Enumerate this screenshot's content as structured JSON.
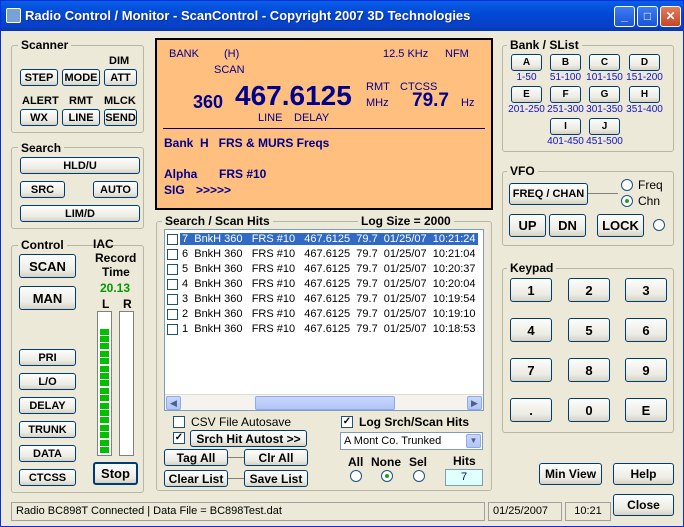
{
  "window": {
    "title": "Radio Control / Monitor - ScanControl - Copyright 2007 3D Technologies",
    "minimize": "_",
    "maximize": "□",
    "close": "✕"
  },
  "scanner": {
    "title": "Scanner",
    "dim_label": "DIM",
    "step": "STEP",
    "mode": "MODE",
    "att": "ATT",
    "alert_label": "ALERT",
    "rmt_label": "RMT",
    "mlck_label": "MLCK",
    "wx": "WX",
    "line": "LINE",
    "send": "SEND"
  },
  "search": {
    "title": "Search",
    "hldu": "HLD/U",
    "src": "SRC",
    "auto": "AUTO",
    "limd": "LIM/D"
  },
  "control": {
    "title": "Control",
    "scan": "SCAN",
    "man": "MAN",
    "pri": "PRI",
    "lo": "L/O",
    "delay": "DELAY",
    "trunk": "TRUNK",
    "data": "DATA",
    "ctcss": "CTCSS"
  },
  "iac": {
    "title": "IAC",
    "record": "Record",
    "time_label": "Time",
    "time_value": "20.13",
    "left": "L",
    "right": "R",
    "stop": "Stop",
    "left_level": 0.9,
    "right_level": 0.0
  },
  "display": {
    "bank": "BANK",
    "bank_id": "(H)",
    "freq_step": "12.5 KHz",
    "mode": "NFM",
    "scan": "SCAN",
    "channel": "360",
    "frequency": "467.6125",
    "rmt": "RMT",
    "mhz": "MHz",
    "ctcss": "CTCSS",
    "tone": "79.7",
    "hz": "Hz",
    "line": "LINE",
    "delay": "DELAY",
    "bank_line": "Bank  H   FRS & MURS Freqs",
    "alpha_label": "Alpha",
    "alpha_value": "FRS #10",
    "sig_label": "SIG",
    "sig_value": ">>>>>"
  },
  "banks": {
    "title": "Bank / SList",
    "items": [
      {
        "key": "A",
        "range": "1-50"
      },
      {
        "key": "B",
        "range": "51-100"
      },
      {
        "key": "C",
        "range": "101-150"
      },
      {
        "key": "D",
        "range": "151-200"
      },
      {
        "key": "E",
        "range": "201-250"
      },
      {
        "key": "F",
        "range": "251-300"
      },
      {
        "key": "G",
        "range": "301-350"
      },
      {
        "key": "H",
        "range": "351-400"
      },
      {
        "key": "I",
        "range": "401-450"
      },
      {
        "key": "J",
        "range": "451-500"
      }
    ]
  },
  "vfo": {
    "title": "VFO",
    "freq_chan": "FREQ / CHAN",
    "freq": "Freq",
    "chn": "Chn",
    "selected": "Chn",
    "up": "UP",
    "dn": "DN",
    "lock": "LOCK"
  },
  "keypad": {
    "title": "Keypad",
    "keys": [
      "1",
      "2",
      "3",
      "4",
      "5",
      "6",
      "7",
      "8",
      "9",
      ".",
      "0",
      "E"
    ]
  },
  "hits": {
    "title": "Search / Scan Hits",
    "log_size": "Log Size = 2000",
    "rows": [
      "7  BnkH 360   FRS #10   467.6125  79.7  01/25/07  10:21:24",
      "6  BnkH 360   FRS #10   467.6125  79.7  01/25/07  10:21:04",
      "5  BnkH 360   FRS #10   467.6125  79.7  01/25/07  10:20:37",
      "4  BnkH 360   FRS #10   467.6125  79.7  01/25/07  10:20:04",
      "3  BnkH 360   FRS #10   467.6125  79.7  01/25/07  10:19:54",
      "2  BnkH 360   FRS #10   467.6125  79.7  01/25/07  10:19:10",
      "1  BnkH 360   FRS #10   467.6125  79.7  01/25/07  10:18:53"
    ],
    "csv_autosave": "CSV File Autosave",
    "srch_autost": "Srch Hit Autost >>",
    "log_srch": "Log Srch/Scan Hits",
    "trunk_select": "A  Mont Co. Trunked",
    "tag_all": "Tag All",
    "clr_all": "Clr All",
    "clear_list": "Clear List",
    "save_list": "Save List",
    "all": "All",
    "none": "None",
    "sel": "Sel",
    "hits_label": "Hits",
    "hits_value": "7"
  },
  "buttons": {
    "min_view": "Min View",
    "help": "Help",
    "close": "Close"
  },
  "status": {
    "message": "Radio BC898T Connected | Data File = BC898Test.dat",
    "date": "01/25/2007",
    "time": "10:21"
  }
}
